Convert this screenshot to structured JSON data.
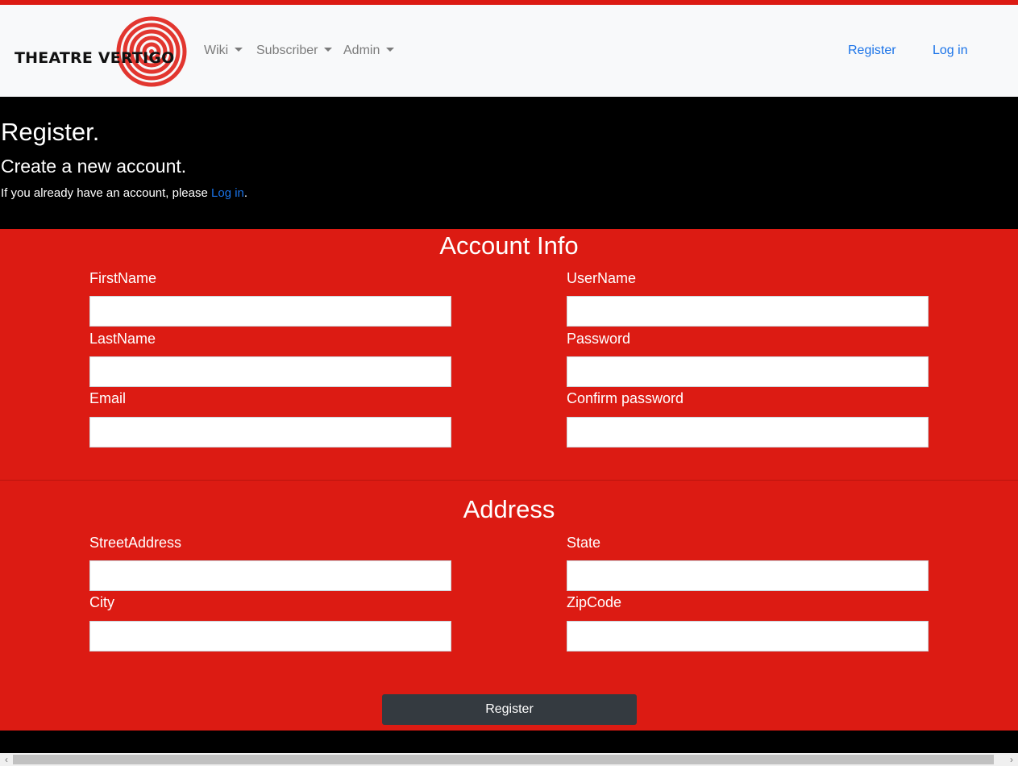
{
  "brand": {
    "logo_text": "THEATRE VERTIGO",
    "logo_color": "#e2362f"
  },
  "nav": {
    "menus": [
      {
        "label": "Wiki"
      },
      {
        "label": "Subscriber"
      },
      {
        "label": "Admin"
      }
    ],
    "register_label": "Register",
    "login_label": "Log in"
  },
  "hero": {
    "title": "Register.",
    "subtitle": "Create a new account.",
    "notice_prefix": "If you already have an account, please ",
    "notice_link": "Log in",
    "notice_suffix": "."
  },
  "account": {
    "title": "Account Info",
    "fields": {
      "first_name": {
        "label": "FirstName",
        "value": ""
      },
      "last_name": {
        "label": "LastName",
        "value": ""
      },
      "email": {
        "label": "Email",
        "value": ""
      },
      "user_name": {
        "label": "UserName",
        "value": ""
      },
      "password": {
        "label": "Password",
        "value": ""
      },
      "confirm_password": {
        "label": "Confirm password",
        "value": ""
      }
    }
  },
  "address": {
    "title": "Address",
    "fields": {
      "street": {
        "label": "StreetAddress",
        "value": ""
      },
      "city": {
        "label": "City",
        "value": ""
      },
      "state": {
        "label": "State",
        "value": ""
      },
      "zip": {
        "label": "ZipCode",
        "value": ""
      }
    }
  },
  "submit_label": "Register",
  "colors": {
    "accent_red": "#dc1b13",
    "link_blue": "#1a73e8",
    "button_dark": "#343a40",
    "hero_bg": "#000000"
  },
  "scrollbar": {
    "left_arrow": "‹",
    "right_arrow": "›"
  }
}
